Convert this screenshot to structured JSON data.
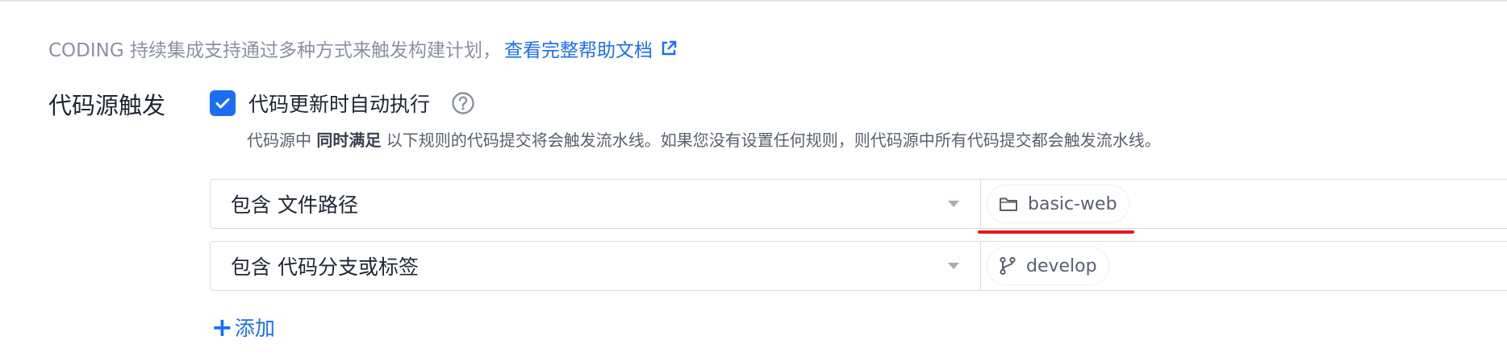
{
  "intro": {
    "text": "CODING 持续集成支持通过多种方式来触发构建计划，",
    "link_label": "查看完整帮助文档"
  },
  "section": {
    "label": "代码源触发"
  },
  "auto_run": {
    "checked": true,
    "label": "代码更新时自动执行",
    "description_prefix": "代码源中",
    "description_emphasis": "同时满足",
    "description_suffix": "以下规则的代码提交将会触发流水线。如果您没有设置任何规则，则代码源中所有代码提交都会触发流水线。"
  },
  "rules": [
    {
      "condition": "包含 文件路径",
      "tag_icon": "folder-icon",
      "tag_value": "basic-web"
    },
    {
      "condition": "包含 代码分支或标签",
      "tag_icon": "branch-icon",
      "tag_value": "develop"
    }
  ],
  "add_button": {
    "label": "添加"
  },
  "colors": {
    "accent": "#1b6ef3",
    "annotation_red": "#e5171f",
    "muted_text": "#8a91a1",
    "border": "#d8dce4"
  }
}
